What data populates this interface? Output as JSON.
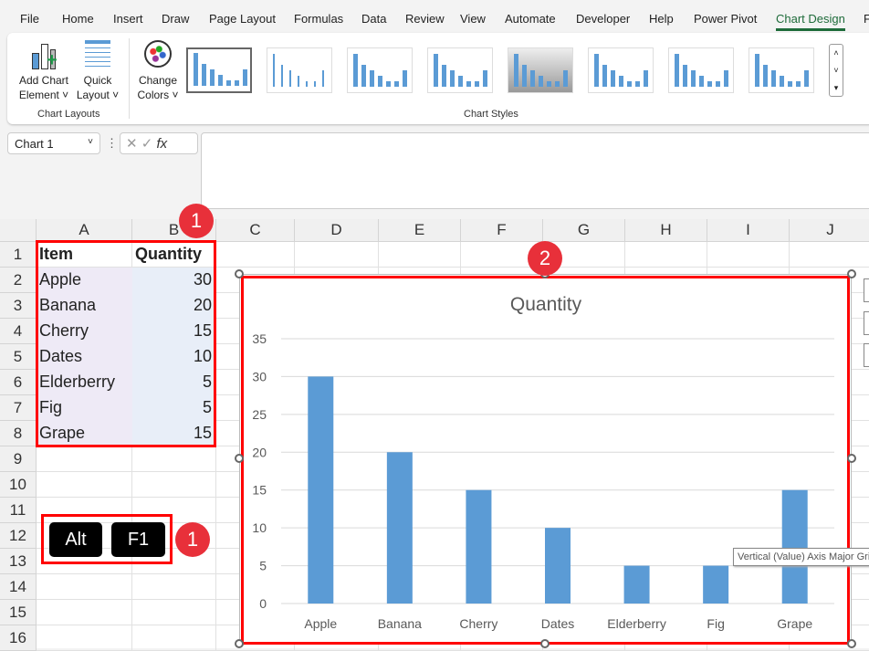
{
  "menu": [
    "File",
    "Home",
    "Insert",
    "Draw",
    "Page Layout",
    "Formulas",
    "Data",
    "Review",
    "View",
    "Automate",
    "Developer",
    "Help",
    "Power Pivot",
    "Chart Design",
    "F"
  ],
  "ribbon": {
    "add_chart_element": [
      "Add Chart",
      "Element"
    ],
    "quick_layout": [
      "Quick",
      "Layout"
    ],
    "change_colors": [
      "Change",
      "Colors"
    ],
    "group_chart_layouts": "Chart Layouts",
    "group_chart_styles": "Chart Styles"
  },
  "name_box": "Chart 1",
  "fx_label": "fx",
  "columns": [
    "A",
    "B",
    "C",
    "D",
    "E",
    "F",
    "G",
    "H",
    "I",
    "J"
  ],
  "rows": [
    "1",
    "2",
    "3",
    "4",
    "5",
    "6",
    "7",
    "8",
    "9",
    "10",
    "11",
    "12",
    "13",
    "14",
    "15",
    "16"
  ],
  "table": {
    "headers": [
      "Item",
      "Quantity"
    ],
    "rows": [
      [
        "Apple",
        "30"
      ],
      [
        "Banana",
        "20"
      ],
      [
        "Cherry",
        "15"
      ],
      [
        "Dates",
        "10"
      ],
      [
        "Elderberry",
        "5"
      ],
      [
        "Fig",
        "5"
      ],
      [
        "Grape",
        "15"
      ]
    ]
  },
  "badges": [
    "1",
    "2",
    "1"
  ],
  "keys": [
    "Alt",
    "F1"
  ],
  "tooltip": "Vertical (Value) Axis Major Gridlines",
  "colors": {
    "bar": "#5b9bd5",
    "highlight": "#ff0000",
    "badge": "#e8303a",
    "accent": "#1e6b3a"
  },
  "chart_data": {
    "type": "bar",
    "title": "Quantity",
    "categories": [
      "Apple",
      "Banana",
      "Cherry",
      "Dates",
      "Elderberry",
      "Fig",
      "Grape"
    ],
    "values": [
      30,
      20,
      15,
      10,
      5,
      5,
      15
    ],
    "ylim": [
      0,
      35
    ],
    "yticks": [
      "0",
      "5",
      "10",
      "15",
      "20",
      "25",
      "30",
      "35"
    ],
    "grid": true
  }
}
